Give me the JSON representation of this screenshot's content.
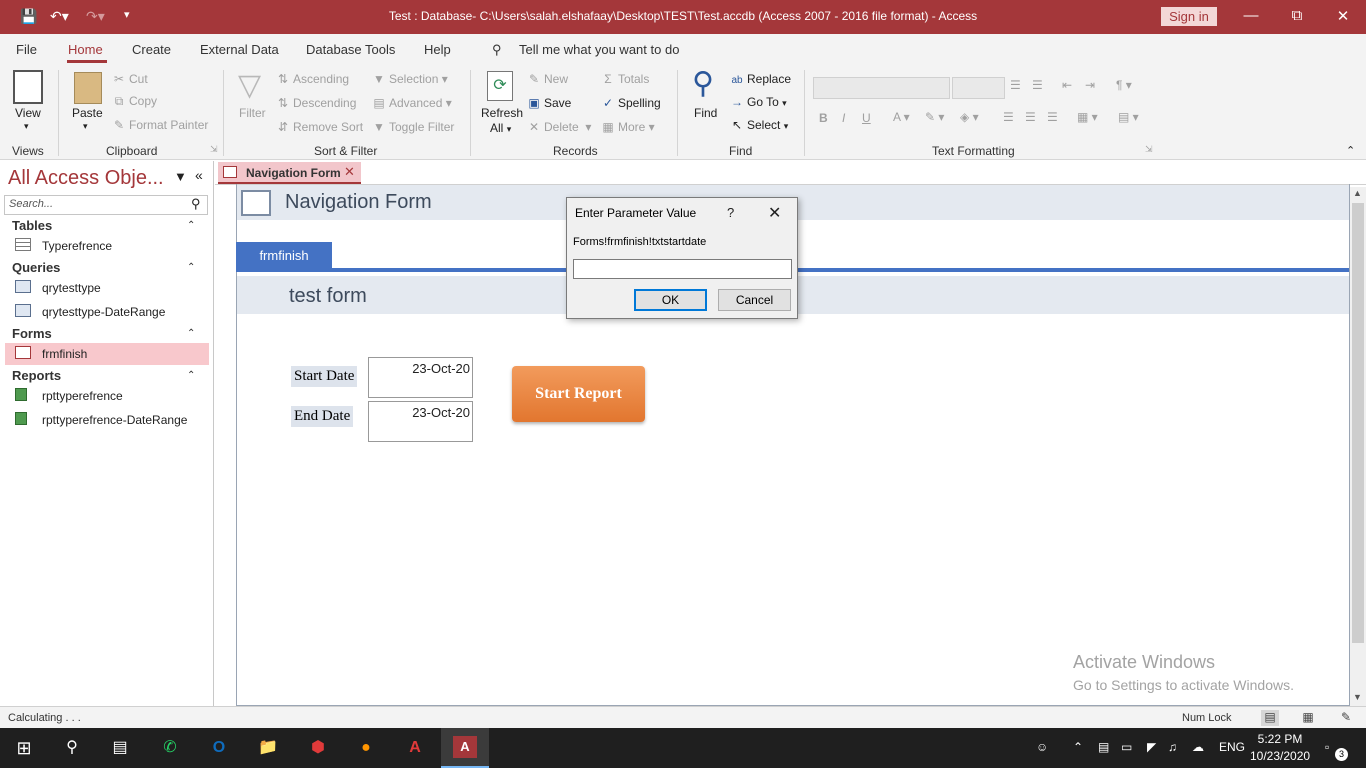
{
  "titlebar": {
    "title": "Test : Database- C:\\Users\\salah.elshafaay\\Desktop\\TEST\\Test.accdb (Access 2007 - 2016 file format)  -  Access",
    "sign_in": "Sign in"
  },
  "menu": {
    "items": [
      "File",
      "Home",
      "Create",
      "External Data",
      "Database Tools",
      "Help"
    ],
    "tell_me": "Tell me what you want to do"
  },
  "ribbon": {
    "views": {
      "view": "View",
      "group": "Views"
    },
    "clipboard": {
      "paste": "Paste",
      "cut": "Cut",
      "copy": "Copy",
      "format_painter": "Format Painter",
      "group": "Clipboard"
    },
    "sort_filter": {
      "filter": "Filter",
      "ascending": "Ascending",
      "descending": "Descending",
      "remove_sort": "Remove Sort",
      "selection": "Selection",
      "advanced": "Advanced",
      "toggle_filter": "Toggle Filter",
      "group": "Sort & Filter"
    },
    "records": {
      "refresh": "Refresh",
      "refresh_all": "All",
      "new": "New",
      "save": "Save",
      "delete": "Delete",
      "totals": "Totals",
      "spelling": "Spelling",
      "more": "More",
      "group": "Records"
    },
    "find": {
      "find": "Find",
      "replace": "Replace",
      "goto": "Go To",
      "select": "Select",
      "group": "Find"
    },
    "text_formatting": {
      "bold": "B",
      "italic": "I",
      "underline": "U",
      "group": "Text Formatting"
    }
  },
  "nav": {
    "title": "All Access Obje...",
    "search_placeholder": "Search...",
    "sections": {
      "tables": {
        "label": "Tables",
        "items": [
          "Typerefrence"
        ]
      },
      "queries": {
        "label": "Queries",
        "items": [
          "qrytesttype",
          "qrytesttype-DateRange"
        ]
      },
      "forms": {
        "label": "Forms",
        "items": [
          "frmfinish"
        ]
      },
      "reports": {
        "label": "Reports",
        "items": [
          "rpttyperefrence",
          "rpttyperefrence-DateRange"
        ]
      }
    }
  },
  "document": {
    "tab_label": "Navigation Form",
    "form_title": "Navigation Form",
    "nav_tab": "frmfinish",
    "subform_title": "test form",
    "start_date_label": "Start Date",
    "start_date_value": "23-Oct-20",
    "end_date_label": "End Date",
    "end_date_value": "23-Oct-20",
    "start_report": "Start Report"
  },
  "dialog": {
    "title": "Enter Parameter Value",
    "help": "?",
    "prompt": "Forms!frmfinish!txtstartdate",
    "value": "",
    "ok": "OK",
    "cancel": "Cancel"
  },
  "watermark": {
    "line1": "Activate Windows",
    "line2": "Go to Settings to activate Windows."
  },
  "status": {
    "text": "Calculating . . .",
    "num_lock": "Num Lock"
  },
  "taskbar": {
    "lang": "ENG",
    "time": "5:22 PM",
    "date": "10/23/2020",
    "notifications": "3"
  },
  "colors": {
    "accent": "#a4373a",
    "nav_tab": "#4472c4",
    "button_orange": "#e9833f"
  }
}
